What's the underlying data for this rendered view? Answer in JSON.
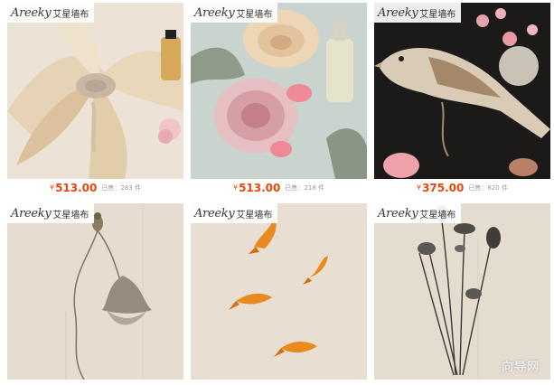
{
  "products": [
    {
      "brand_logo": "Areeky",
      "brand_cn": "艾星墙布",
      "currency": "¥",
      "price": "513.00",
      "sold_label": "已售：",
      "sold_count": "283",
      "sold_unit": "件"
    },
    {
      "brand_logo": "Areeky",
      "brand_cn": "艾星墙布",
      "currency": "¥",
      "price": "513.00",
      "sold_label": "已售：",
      "sold_count": "218",
      "sold_unit": "件"
    },
    {
      "brand_logo": "Areeky",
      "brand_cn": "艾星墙布",
      "currency": "¥",
      "price": "375.00",
      "sold_label": "已售：",
      "sold_count": "820",
      "sold_unit": "件"
    },
    {
      "brand_logo": "Areeky",
      "brand_cn": "艾星墙布"
    },
    {
      "brand_logo": "Areeky",
      "brand_cn": "艾星墙布"
    },
    {
      "brand_logo": "Areeky",
      "brand_cn": "艾星墙布"
    }
  ],
  "watermark": "向导网"
}
